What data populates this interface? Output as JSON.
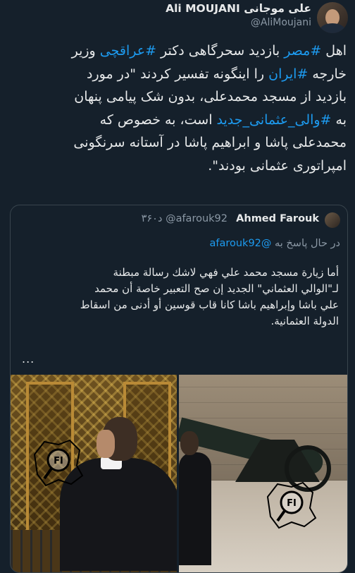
{
  "author": {
    "display_name": "علی موجانی Ali MOUJANI",
    "handle": "@AliMoujani"
  },
  "tweet": {
    "lines": [
      [
        {
          "text": "اهل ",
          "hl": false
        },
        {
          "text": "#مصر",
          "hl": true
        },
        {
          "text": " بازدید سحرگاهی دکتر ",
          "hl": false
        },
        {
          "text": "#عراقچی",
          "hl": true
        },
        {
          "text": " وزیر",
          "hl": false
        }
      ],
      [
        {
          "text": "خارجه ",
          "hl": false
        },
        {
          "text": "#ایران",
          "hl": true
        },
        {
          "text": " را اینگونه تفسیر کردند \"در مورد",
          "hl": false
        }
      ],
      [
        {
          "text": "بازدید از مسجد محمدعلی، بدون شک پیامی پنهان",
          "hl": false
        }
      ],
      [
        {
          "text": "به ",
          "hl": false
        },
        {
          "text": "#والی_عثمانی_جدید",
          "hl": true
        },
        {
          "text": " است، به خصوص که",
          "hl": false
        }
      ],
      [
        {
          "text": "محمدعلی پاشا و ابراهیم پاشا در آستانه سرنگونی",
          "hl": false
        }
      ],
      [
        {
          "text": "امپراتوری عثمانی بودند\".",
          "hl": false
        }
      ]
    ]
  },
  "quoted": {
    "name": "Ahmed Farouk",
    "handle": "@afarouk92",
    "time": "۳۶۰د",
    "reply_label": "در حال پاسخ به",
    "reply_handle": "@afarouk92",
    "lines": [
      "أما زيارة مسجد محمد علي فهي لاشك رسالة مبطنة",
      "لـ\"الوالي العثماني\" الجديد إن صح التعبير خاصة أن محمد",
      "علي باشا وإبراهيم باشا كانا قاب قوسين أو أدنى من اسقاط",
      "الدولة العثمانية."
    ],
    "ellipsis": "...",
    "watermark_text": "FI"
  }
}
